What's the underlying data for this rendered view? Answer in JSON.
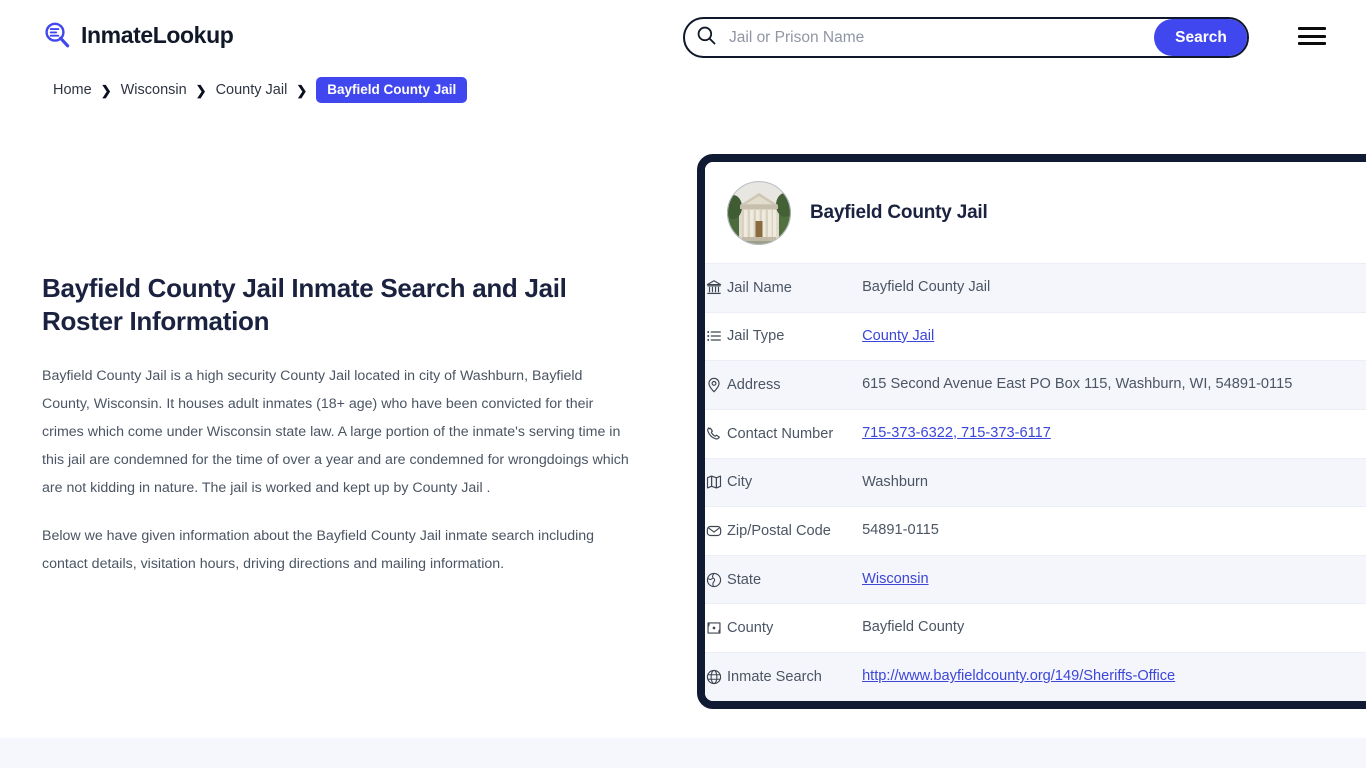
{
  "brand": {
    "name": "InmateLookup",
    "logo_icon": "magnifier-list-icon",
    "accent_color": "#4147ee"
  },
  "search": {
    "icon": "search-icon",
    "placeholder": "Jail or Prison Name",
    "value": "",
    "button_label": "Search"
  },
  "menu": {
    "icon": "hamburger-menu-icon"
  },
  "breadcrumb": {
    "items": [
      {
        "label": "Home",
        "current": false
      },
      {
        "label": "Wisconsin",
        "current": false
      },
      {
        "label": "County Jail",
        "current": false
      },
      {
        "label": "Bayfield County Jail",
        "current": true
      }
    ],
    "separator": "❯"
  },
  "main": {
    "heading": "Bayfield County Jail Inmate Search and Jail Roster Information",
    "paragraphs": [
      "Bayfield County Jail is a high security County Jail located in city of Washburn, Bayfield County, Wisconsin. It houses adult inmates (18+ age) who have been convicted for their crimes which come under Wisconsin state law. A large portion of the inmate's serving time in this jail are condemned for the time of over a year and are condemned for wrongdoings which are not kidding in nature. The jail is worked and kept up by County Jail .",
      "Below we have given information about the Bayfield County Jail inmate search including contact details, visitation hours, driving directions and mailing information."
    ]
  },
  "card": {
    "title": "Bayfield County Jail",
    "thumbnail_icon": "courthouse-photo",
    "border_color": "#111a33",
    "rows": [
      {
        "icon": "bank-icon",
        "label": "Jail Name",
        "value": "Bayfield County Jail",
        "link": false
      },
      {
        "icon": "list-icon",
        "label": "Jail Type",
        "value": "County Jail",
        "link": true
      },
      {
        "icon": "map-pin-icon",
        "label": "Address",
        "value": "615 Second Avenue East PO Box 115, Washburn, WI, 54891-0115",
        "link": false
      },
      {
        "icon": "phone-icon",
        "label": "Contact Number",
        "value": "715-373-6322, 715-373-6117",
        "link": true
      },
      {
        "icon": "map-icon",
        "label": "City",
        "value": "Washburn",
        "link": false
      },
      {
        "icon": "envelope-icon",
        "label": "Zip/Postal Code",
        "value": "54891-0115",
        "link": false
      },
      {
        "icon": "globe-icon",
        "label": "State",
        "value": "Wisconsin",
        "link": true
      },
      {
        "icon": "county-map-icon",
        "label": "County",
        "value": "Bayfield County",
        "link": false
      },
      {
        "icon": "www-globe-icon",
        "label": "Inmate Search",
        "value": "http://www.bayfieldcounty.org/149/Sheriffs-Office",
        "link": true
      }
    ]
  }
}
